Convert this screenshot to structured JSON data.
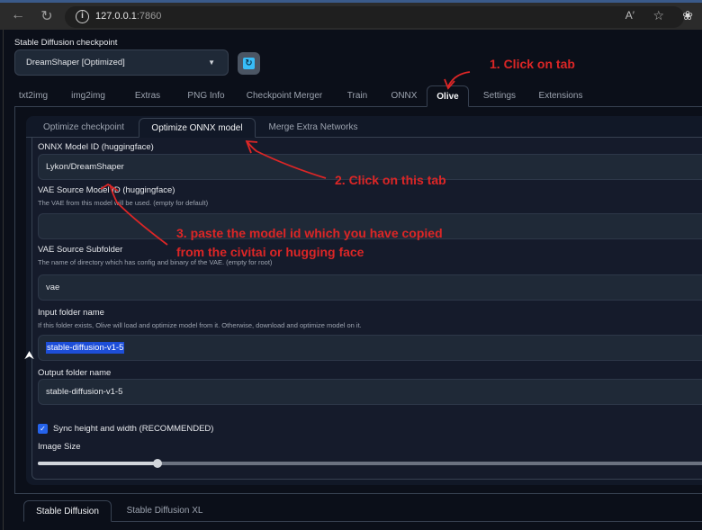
{
  "browser": {
    "url_host": "127.0.0.1",
    "url_port": ":7860",
    "icons": [
      "back-arrow-icon",
      "reload-icon",
      "info-icon",
      "read-aloud-icon",
      "favorite-star-icon",
      "extensions-icon"
    ]
  },
  "checkpoint": {
    "label": "Stable Diffusion checkpoint",
    "value": "DreamShaper [Optimized]",
    "refresh_icon": "refresh-icon"
  },
  "main_tabs": [
    {
      "label": "txt2img",
      "active": false
    },
    {
      "label": "img2img",
      "active": false
    },
    {
      "label": "Extras",
      "active": false
    },
    {
      "label": "PNG Info",
      "active": false
    },
    {
      "label": "Checkpoint Merger",
      "active": false
    },
    {
      "label": "Train",
      "active": false
    },
    {
      "label": "ONNX",
      "active": false
    },
    {
      "label": "Olive",
      "active": true
    },
    {
      "label": "Settings",
      "active": false
    },
    {
      "label": "Extensions",
      "active": false
    }
  ],
  "olive_tabs": [
    {
      "label": "Optimize checkpoint",
      "active": false
    },
    {
      "label": "Optimize ONNX model",
      "active": true
    },
    {
      "label": "Merge Extra Networks",
      "active": false
    }
  ],
  "form": {
    "onnx_model_id": {
      "label": "ONNX Model ID (huggingface)",
      "value": "Lykon/DreamShaper"
    },
    "vae_source_model_id": {
      "label": "VAE Source Model ID (huggingface)",
      "help": "The VAE from this model will be used. (empty for default)",
      "value": ""
    },
    "vae_source_subfolder": {
      "label": "VAE Source Subfolder",
      "help": "The name of directory which has config and binary of the VAE. (empty for root)",
      "value": "vae"
    },
    "input_folder": {
      "label": "Input folder name",
      "help": "If this folder exists, Olive will load and optimize model from it. Otherwise, download and optimize model on it.",
      "value": "stable-diffusion-v1-5"
    },
    "output_folder": {
      "label": "Output folder name",
      "value": "stable-diffusion-v1-5"
    },
    "sync_checkbox": {
      "label": "Sync height and width (RECOMMENDED)",
      "checked": true
    },
    "image_size": {
      "label": "Image Size",
      "slider_fraction": 0.18
    }
  },
  "model_tabs": [
    {
      "label": "Stable Diffusion",
      "active": true
    },
    {
      "label": "Stable Diffusion XL",
      "active": false
    }
  ],
  "annotations": {
    "step1": "1. Click on tab",
    "step2": "2. Click on this tab",
    "step3_line1": "3. paste the model id which you have copied",
    "step3_line2": "from the civitai or hugging face",
    "color": "#dc2626"
  }
}
